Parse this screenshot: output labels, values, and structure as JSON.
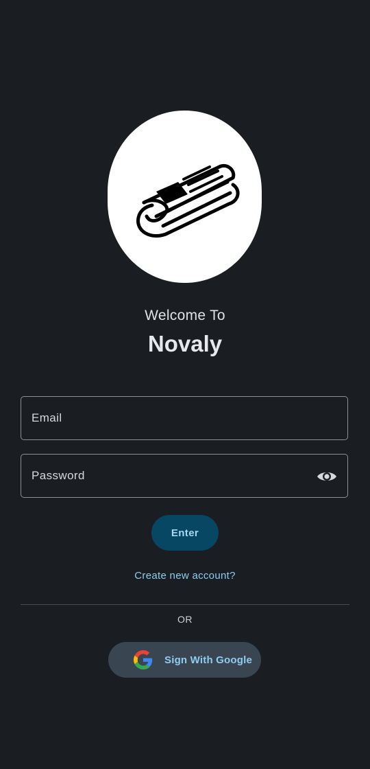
{
  "header": {
    "welcome_text": "Welcome To",
    "app_name": "Novaly",
    "logo_icon": "newspaper-icon"
  },
  "form": {
    "email_placeholder": "Email",
    "email_value": "",
    "password_placeholder": "Password",
    "password_value": "",
    "visibility_icon": "eye-icon",
    "enter_label": "Enter",
    "create_account_label": "Create new account?"
  },
  "alt_login": {
    "or_label": "OR",
    "google_label": "Sign With Google",
    "google_icon": "google-g-icon"
  },
  "colors": {
    "background": "#1a1d21",
    "primary_button": "#074763",
    "link": "#8fcdf0",
    "google_button": "#394550"
  }
}
